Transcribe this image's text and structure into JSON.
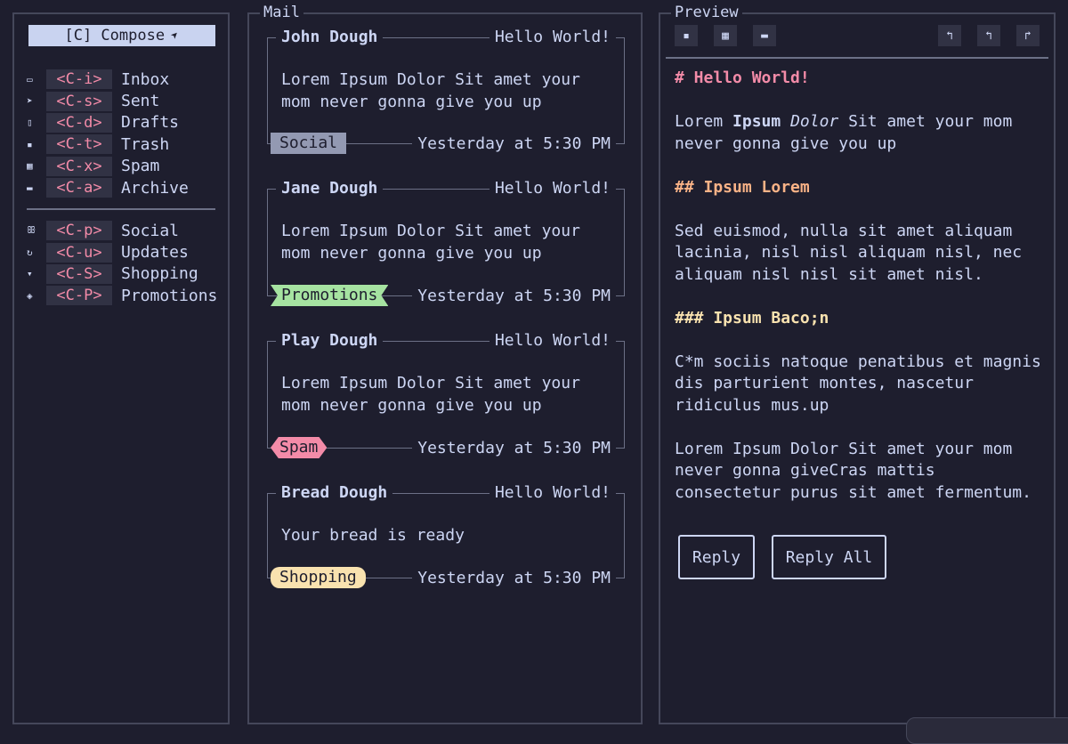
{
  "sidebar": {
    "compose_label": "[C] Compose",
    "folders": [
      {
        "icon": "inbox-icon",
        "glyph": "▭",
        "key": "<C-i>",
        "label": "Inbox"
      },
      {
        "icon": "send-icon",
        "glyph": "➤",
        "key": "<C-s>",
        "label": "Sent"
      },
      {
        "icon": "file-icon",
        "glyph": "▯",
        "key": "<C-d>",
        "label": "Drafts"
      },
      {
        "icon": "trash-icon",
        "glyph": "▪",
        "key": "<C-t>",
        "label": "Trash"
      },
      {
        "icon": "spam-icon",
        "glyph": "▦",
        "key": "<C-x>",
        "label": "Spam"
      },
      {
        "icon": "archive-icon",
        "glyph": "▬",
        "key": "<C-a>",
        "label": "Archive"
      }
    ],
    "categories": [
      {
        "icon": "people-icon",
        "glyph": "ꕥ",
        "key": "<C-p>",
        "label": "Social"
      },
      {
        "icon": "updates-icon",
        "glyph": "↻",
        "key": "<C-u>",
        "label": "Updates"
      },
      {
        "icon": "cart-icon",
        "glyph": "▾",
        "key": "<C-S>",
        "label": "Shopping"
      },
      {
        "icon": "tag-icon",
        "glyph": "◈",
        "key": "<C-P>",
        "label": "Promotions"
      }
    ]
  },
  "mail": {
    "title": "Mail",
    "messages": [
      {
        "sender": "John Dough",
        "subject": "Hello World!",
        "body": "Lorem Ipsum Dolor Sit amet your mom never gonna give you up",
        "tag": "Social",
        "date": "Yesterday at 5:30 PM"
      },
      {
        "sender": "Jane Dough",
        "subject": "Hello World!",
        "body": "Lorem Ipsum Dolor Sit amet your mom never gonna give you up",
        "tag": "Promotions",
        "date": "Yesterday at 5:30 PM"
      },
      {
        "sender": "Play Dough",
        "subject": "Hello World!",
        "body": "Lorem Ipsum Dolor Sit amet your mom never gonna give you up",
        "tag": "Spam",
        "date": "Yesterday at 5:30 PM"
      },
      {
        "sender": "Bread Dough",
        "subject": "Hello World!",
        "body": "Your bread is ready",
        "tag": "Shopping",
        "date": "Yesterday at 5:30 PM"
      }
    ]
  },
  "preview": {
    "title": "Preview",
    "h1": "# Hello World!",
    "p1_a": "Lorem ",
    "p1_bold": "Ipsum",
    "p1_space": " ",
    "p1_italic": "Dolor",
    "p1_b": " Sit amet your mom never gonna give you up",
    "h2": "## Ipsum Lorem",
    "p2": "Sed euismod, nulla sit amet aliquam lacinia, nisl nisl aliquam nisl, nec aliquam nisl nisl sit amet nisl.",
    "h3": "### Ipsum Baco;n",
    "p3": "C*m sociis natoque penatibus et magnis dis parturient montes, nascetur ridiculus mus.up",
    "p4": "Lorem Ipsum Dolor Sit amet your mom never gonna giveCras mattis consectetur purus sit amet fermentum.",
    "reply_label": "Reply",
    "reply_all_label": "Reply All"
  },
  "colors": {
    "background": "#1e1e2e",
    "text": "#cdd6f4",
    "key_accent": "#f38ba8",
    "social": "#9399b2",
    "promotions": "#a6e3a1",
    "spam": "#f38ba8",
    "shopping": "#f9e2af",
    "h2": "#fab387"
  }
}
